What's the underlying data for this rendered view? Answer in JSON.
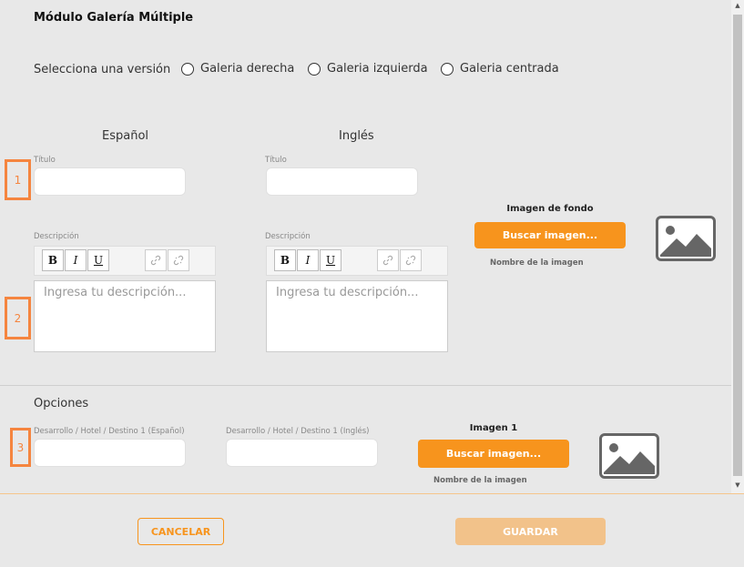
{
  "header": {
    "title": "Módulo Galería Múltiple"
  },
  "version": {
    "label": "Selecciona una versión",
    "options": [
      "Galeria derecha",
      "Galeria izquierda",
      "Galeria centrada"
    ]
  },
  "columns": {
    "spanish": "Español",
    "english": "Inglés"
  },
  "markers": [
    "1",
    "2",
    "3"
  ],
  "form": {
    "title_label": "Título",
    "description_label": "Descripción",
    "description_placeholder": "Ingresa tu descripción..."
  },
  "toolbar": {
    "bold": "B",
    "italic": "I",
    "underline": "U",
    "link_icon": "link-icon",
    "unlink_icon": "unlink-icon"
  },
  "background_image": {
    "label": "Imagen de fondo",
    "button": "Buscar imagen...",
    "filename": "Nombre de la imagen",
    "icon": "image-placeholder-icon"
  },
  "options": {
    "title": "Opciones",
    "field_es_label": "Desarrollo / Hotel / Destino 1 (Español)",
    "field_en_label": "Desarrollo / Hotel / Destino 1 (Inglés)",
    "image_label": "Imagen 1",
    "image_button": "Buscar imagen...",
    "image_filename": "Nombre de la imagen"
  },
  "footer": {
    "cancel": "CANCELAR",
    "save": "GUARDAR"
  },
  "colors": {
    "accent": "#f7941d",
    "marker": "#f5853f",
    "save_disabled": "#f2c28a",
    "background": "#e8e8e8"
  }
}
